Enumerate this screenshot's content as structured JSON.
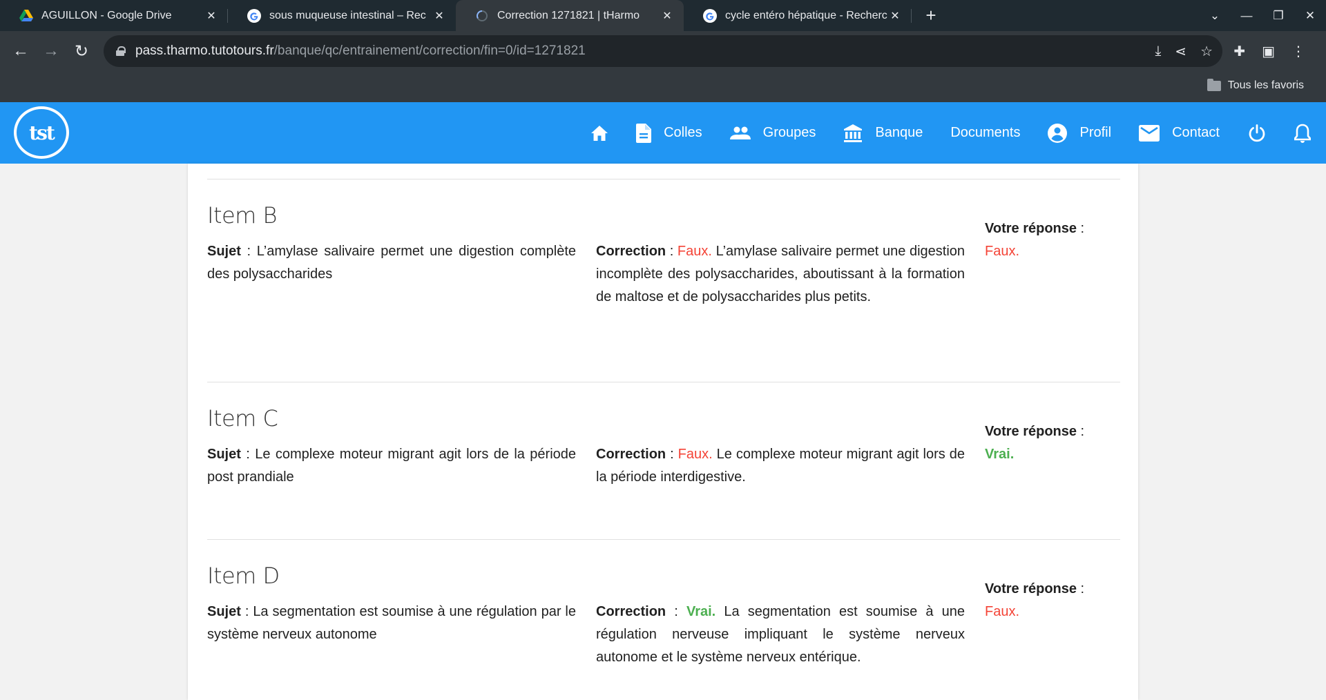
{
  "browser": {
    "tabs": [
      {
        "title": "AGUILLON - Google Drive",
        "icon": "google-drive-icon",
        "active": false
      },
      {
        "title": "sous muqueuse intestinal – Rec",
        "icon": "google-icon",
        "active": false
      },
      {
        "title": "Correction 1271821 | tHarmo",
        "icon": "loading-icon",
        "active": true
      },
      {
        "title": "cycle entéro hépatique - Recherc",
        "icon": "google-icon",
        "active": false
      }
    ],
    "new_tab": "+",
    "url_host": "pass.tharmo.tutotours.fr",
    "url_path": "/banque/qc/entrainement/correction/fin=0/id=1271821",
    "bookmarks_all": "Tous les favoris"
  },
  "site": {
    "logo_text": "tst",
    "accent": "#2196f3",
    "menu": {
      "colles": "Colles",
      "groupes": "Groupes",
      "banque": "Banque",
      "documents": "Documents",
      "profil": "Profil",
      "contact": "Contact"
    }
  },
  "labels": {
    "sujet": "Sujet",
    "correction": "Correction",
    "votre_reponse": "Votre réponse",
    "sep": " : "
  },
  "items": [
    {
      "title": "Item B",
      "sujet": "L’amylase salivaire permet une digestion complète des polysaccharides",
      "correction_verdict": "Faux.",
      "correction_verdict_class": "faux",
      "correction_text": "L’amylase salivaire permet une digestion incomplète des polysaccharides, aboutissant à la formation de maltose et de polysaccharides plus petits.",
      "reponse": "Faux.",
      "reponse_class": "faux"
    },
    {
      "title": "Item C",
      "sujet": "Le complexe moteur migrant agit lors de la période post prandiale",
      "correction_verdict": "Faux.",
      "correction_verdict_class": "faux",
      "correction_text": "Le complexe moteur migrant agit lors de la période interdigestive.",
      "reponse": "Vrai.",
      "reponse_class": "vrai"
    },
    {
      "title": "Item D",
      "sujet": "La segmentation est soumise à une régulation par le système nerveux autonome",
      "correction_verdict": "Vrai.",
      "correction_verdict_class": "vrai",
      "correction_text": "La segmentation est soumise à une régulation nerveuse impliquant le système nerveux autonome et le système nerveux entérique.",
      "reponse": "Faux.",
      "reponse_class": "faux"
    }
  ],
  "colors": {
    "faux": "#f44336",
    "vrai": "#4caf50"
  }
}
